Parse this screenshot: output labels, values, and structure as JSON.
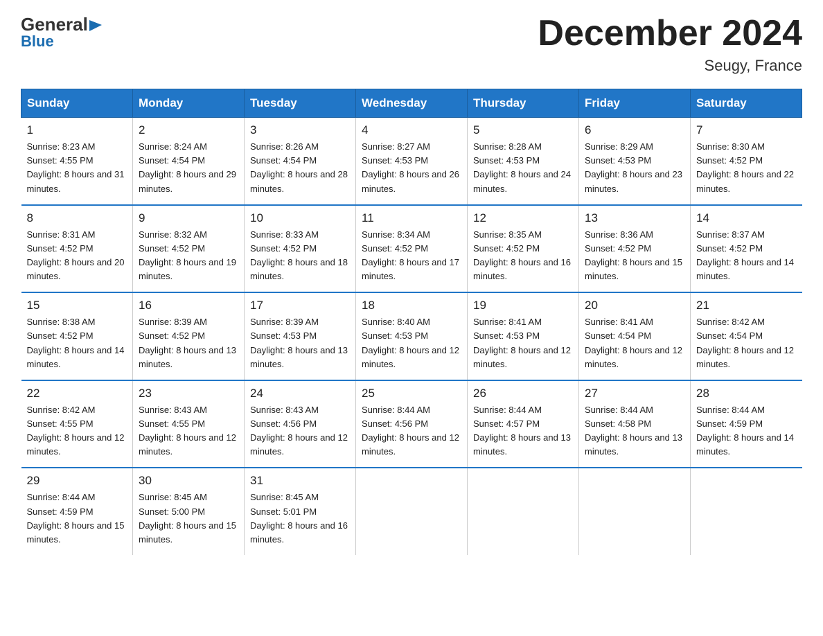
{
  "logo": {
    "general": "General",
    "blue": "Blue",
    "triangle": "▶"
  },
  "title": "December 2024",
  "location": "Seugy, France",
  "headers": [
    "Sunday",
    "Monday",
    "Tuesday",
    "Wednesday",
    "Thursday",
    "Friday",
    "Saturday"
  ],
  "weeks": [
    [
      {
        "day": "1",
        "sunrise": "8:23 AM",
        "sunset": "4:55 PM",
        "daylight": "8 hours and 31 minutes."
      },
      {
        "day": "2",
        "sunrise": "8:24 AM",
        "sunset": "4:54 PM",
        "daylight": "8 hours and 29 minutes."
      },
      {
        "day": "3",
        "sunrise": "8:26 AM",
        "sunset": "4:54 PM",
        "daylight": "8 hours and 28 minutes."
      },
      {
        "day": "4",
        "sunrise": "8:27 AM",
        "sunset": "4:53 PM",
        "daylight": "8 hours and 26 minutes."
      },
      {
        "day": "5",
        "sunrise": "8:28 AM",
        "sunset": "4:53 PM",
        "daylight": "8 hours and 24 minutes."
      },
      {
        "day": "6",
        "sunrise": "8:29 AM",
        "sunset": "4:53 PM",
        "daylight": "8 hours and 23 minutes."
      },
      {
        "day": "7",
        "sunrise": "8:30 AM",
        "sunset": "4:52 PM",
        "daylight": "8 hours and 22 minutes."
      }
    ],
    [
      {
        "day": "8",
        "sunrise": "8:31 AM",
        "sunset": "4:52 PM",
        "daylight": "8 hours and 20 minutes."
      },
      {
        "day": "9",
        "sunrise": "8:32 AM",
        "sunset": "4:52 PM",
        "daylight": "8 hours and 19 minutes."
      },
      {
        "day": "10",
        "sunrise": "8:33 AM",
        "sunset": "4:52 PM",
        "daylight": "8 hours and 18 minutes."
      },
      {
        "day": "11",
        "sunrise": "8:34 AM",
        "sunset": "4:52 PM",
        "daylight": "8 hours and 17 minutes."
      },
      {
        "day": "12",
        "sunrise": "8:35 AM",
        "sunset": "4:52 PM",
        "daylight": "8 hours and 16 minutes."
      },
      {
        "day": "13",
        "sunrise": "8:36 AM",
        "sunset": "4:52 PM",
        "daylight": "8 hours and 15 minutes."
      },
      {
        "day": "14",
        "sunrise": "8:37 AM",
        "sunset": "4:52 PM",
        "daylight": "8 hours and 14 minutes."
      }
    ],
    [
      {
        "day": "15",
        "sunrise": "8:38 AM",
        "sunset": "4:52 PM",
        "daylight": "8 hours and 14 minutes."
      },
      {
        "day": "16",
        "sunrise": "8:39 AM",
        "sunset": "4:52 PM",
        "daylight": "8 hours and 13 minutes."
      },
      {
        "day": "17",
        "sunrise": "8:39 AM",
        "sunset": "4:53 PM",
        "daylight": "8 hours and 13 minutes."
      },
      {
        "day": "18",
        "sunrise": "8:40 AM",
        "sunset": "4:53 PM",
        "daylight": "8 hours and 12 minutes."
      },
      {
        "day": "19",
        "sunrise": "8:41 AM",
        "sunset": "4:53 PM",
        "daylight": "8 hours and 12 minutes."
      },
      {
        "day": "20",
        "sunrise": "8:41 AM",
        "sunset": "4:54 PM",
        "daylight": "8 hours and 12 minutes."
      },
      {
        "day": "21",
        "sunrise": "8:42 AM",
        "sunset": "4:54 PM",
        "daylight": "8 hours and 12 minutes."
      }
    ],
    [
      {
        "day": "22",
        "sunrise": "8:42 AM",
        "sunset": "4:55 PM",
        "daylight": "8 hours and 12 minutes."
      },
      {
        "day": "23",
        "sunrise": "8:43 AM",
        "sunset": "4:55 PM",
        "daylight": "8 hours and 12 minutes."
      },
      {
        "day": "24",
        "sunrise": "8:43 AM",
        "sunset": "4:56 PM",
        "daylight": "8 hours and 12 minutes."
      },
      {
        "day": "25",
        "sunrise": "8:44 AM",
        "sunset": "4:56 PM",
        "daylight": "8 hours and 12 minutes."
      },
      {
        "day": "26",
        "sunrise": "8:44 AM",
        "sunset": "4:57 PM",
        "daylight": "8 hours and 13 minutes."
      },
      {
        "day": "27",
        "sunrise": "8:44 AM",
        "sunset": "4:58 PM",
        "daylight": "8 hours and 13 minutes."
      },
      {
        "day": "28",
        "sunrise": "8:44 AM",
        "sunset": "4:59 PM",
        "daylight": "8 hours and 14 minutes."
      }
    ],
    [
      {
        "day": "29",
        "sunrise": "8:44 AM",
        "sunset": "4:59 PM",
        "daylight": "8 hours and 15 minutes."
      },
      {
        "day": "30",
        "sunrise": "8:45 AM",
        "sunset": "5:00 PM",
        "daylight": "8 hours and 15 minutes."
      },
      {
        "day": "31",
        "sunrise": "8:45 AM",
        "sunset": "5:01 PM",
        "daylight": "8 hours and 16 minutes."
      },
      null,
      null,
      null,
      null
    ]
  ]
}
